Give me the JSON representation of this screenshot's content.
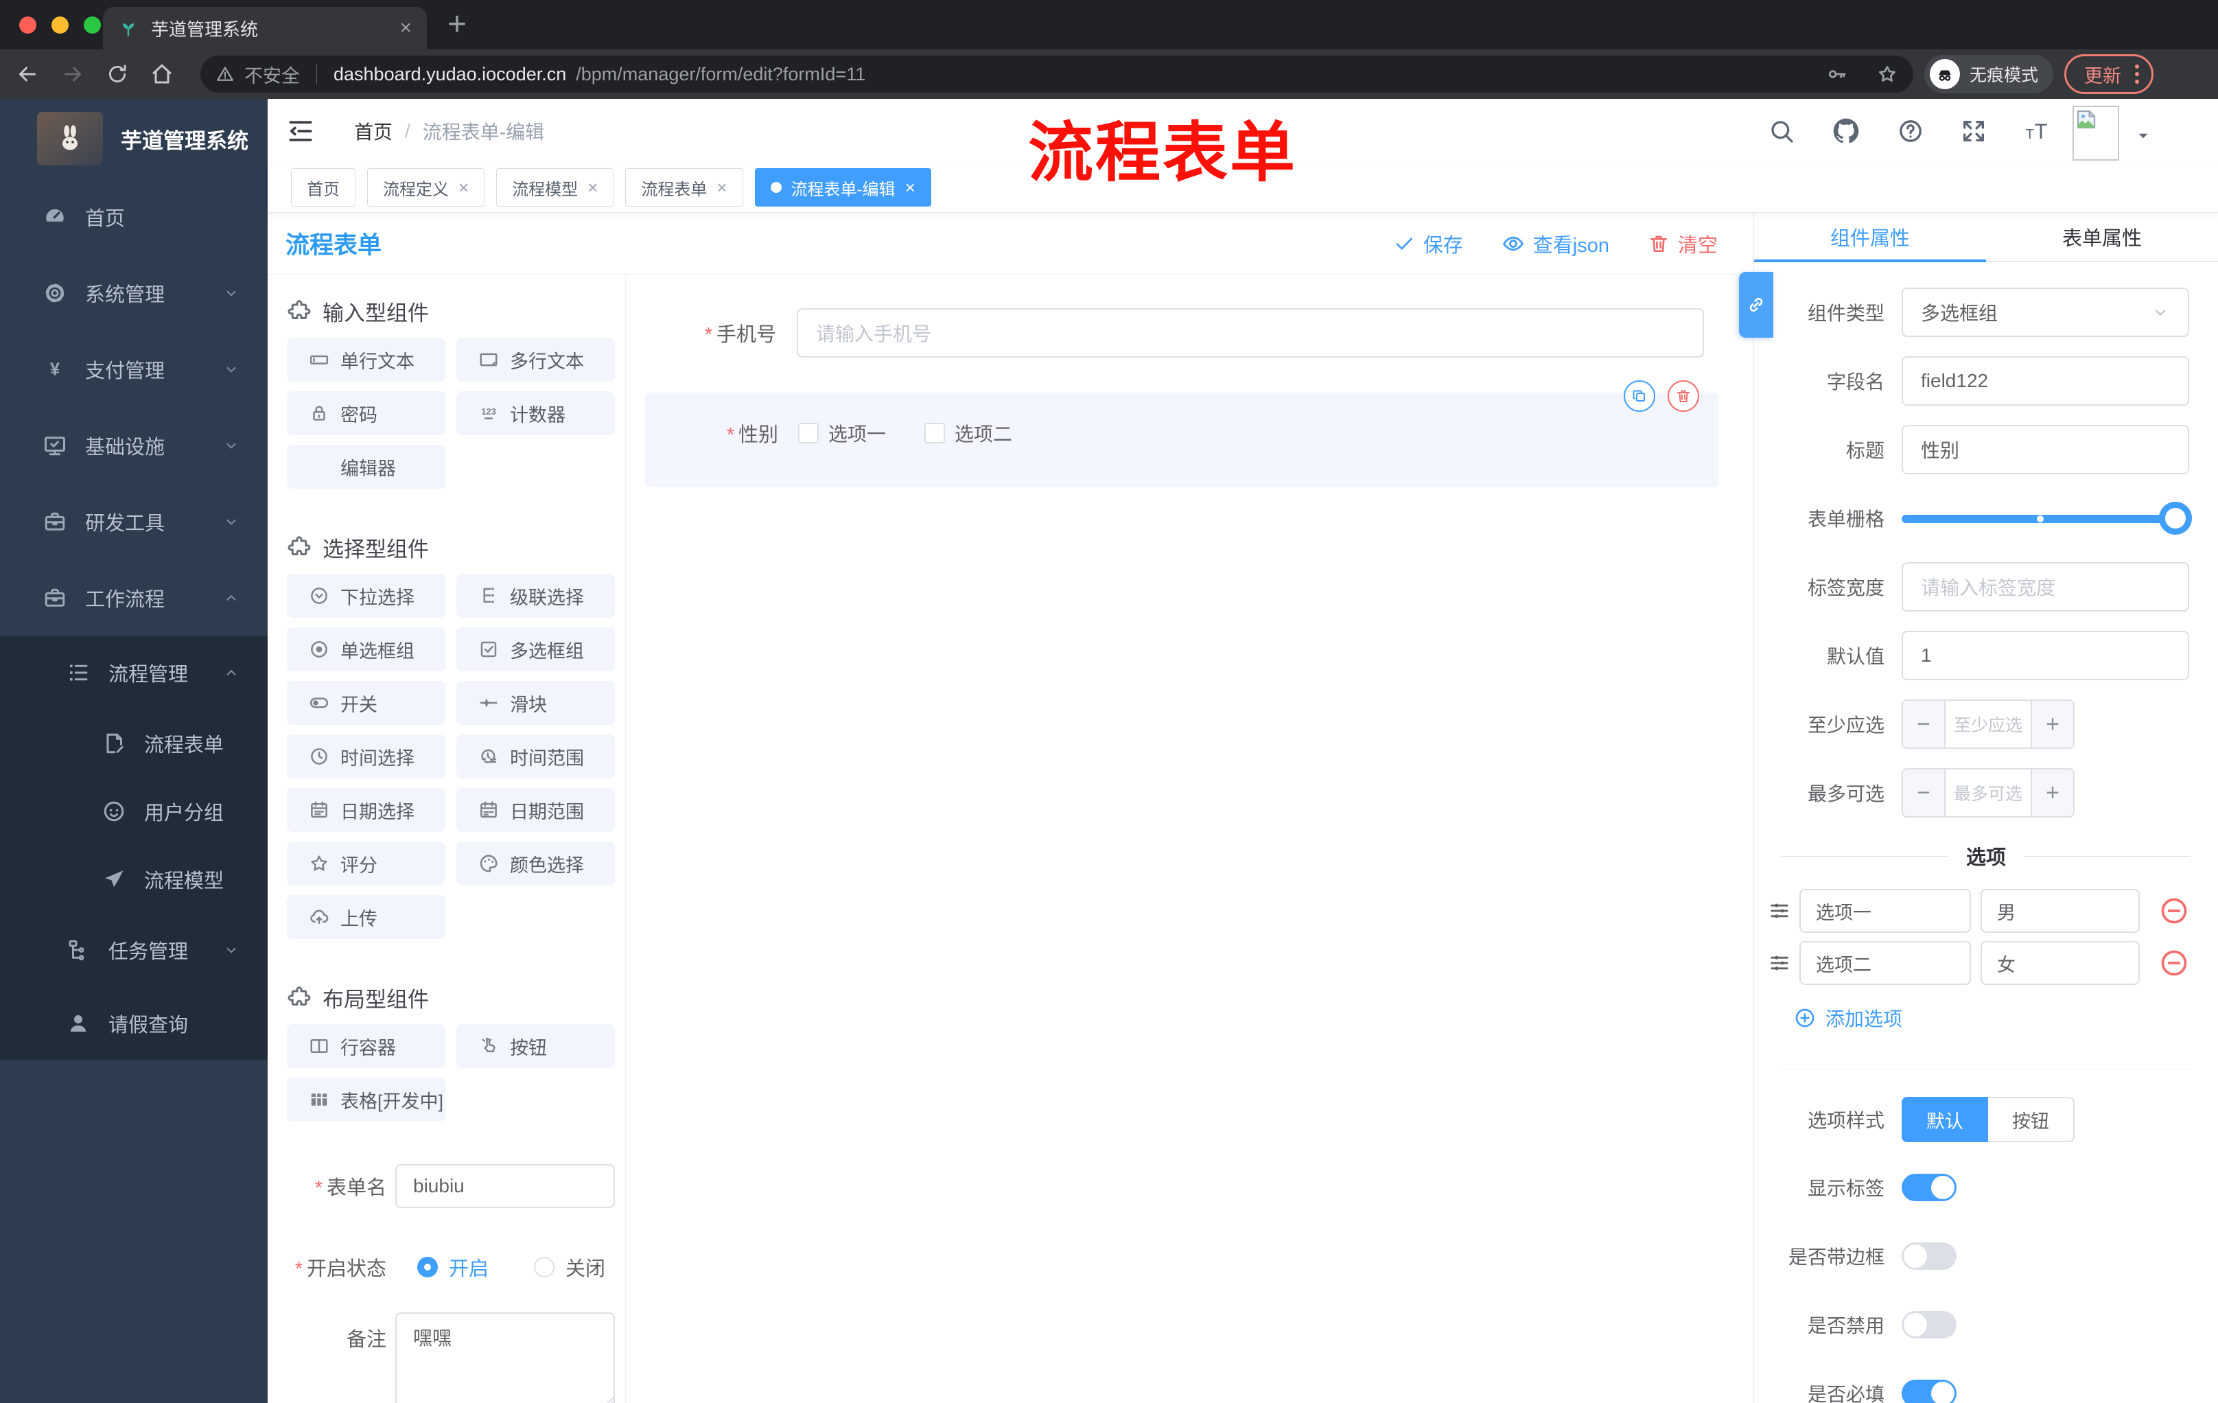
{
  "browser": {
    "tab_title": "芋道管理系统",
    "security_label": "不安全",
    "url_host": "dashboard.yudao.iocoder.cn",
    "url_path": "/bpm/manager/form/edit?formId=11",
    "incognito_label": "无痕模式",
    "update_label": "更新"
  },
  "sidebar": {
    "logo_title": "芋道管理系统",
    "items": [
      {
        "label": "首页",
        "icon": "dashboard",
        "level": 1,
        "chevron": "",
        "sub": false
      },
      {
        "label": "系统管理",
        "icon": "gear",
        "level": 1,
        "chevron": "down",
        "sub": false
      },
      {
        "label": "支付管理",
        "icon": "yen",
        "level": 1,
        "chevron": "down",
        "sub": false
      },
      {
        "label": "基础设施",
        "icon": "monitor",
        "level": 1,
        "chevron": "down",
        "sub": false
      },
      {
        "label": "研发工具",
        "icon": "briefcase",
        "level": 1,
        "chevron": "down",
        "sub": false
      },
      {
        "label": "工作流程",
        "icon": "briefcase",
        "level": 1,
        "chevron": "up",
        "sub": false
      },
      {
        "label": "流程管理",
        "icon": "flowlist",
        "level": 2,
        "chevron": "up",
        "sub": true
      },
      {
        "label": "流程表单",
        "icon": "docedit",
        "level": 3,
        "chevron": "",
        "sub": true
      },
      {
        "label": "用户分组",
        "icon": "face",
        "level": 3,
        "chevron": "",
        "sub": true
      },
      {
        "label": "流程模型",
        "icon": "plane",
        "level": 3,
        "chevron": "",
        "sub": true
      },
      {
        "label": "任务管理",
        "icon": "tree",
        "level": 2,
        "chevron": "down",
        "sub": true
      },
      {
        "label": "请假查询",
        "icon": "person",
        "level": 2,
        "chevron": "",
        "sub": true
      }
    ]
  },
  "header": {
    "breadcrumb": [
      "首页",
      "流程表单-编辑"
    ],
    "annotation": "流程表单"
  },
  "tabs": [
    {
      "label": "首页",
      "closable": false,
      "active": false
    },
    {
      "label": "流程定义",
      "closable": true,
      "active": false
    },
    {
      "label": "流程模型",
      "closable": true,
      "active": false
    },
    {
      "label": "流程表单",
      "closable": true,
      "active": false
    },
    {
      "label": "流程表单-编辑",
      "closable": true,
      "active": true
    }
  ],
  "editor": {
    "title": "流程表单",
    "actions": {
      "save": "保存",
      "view_json": "查看json",
      "clear": "清空"
    }
  },
  "palette": {
    "sections": [
      {
        "title": "输入型组件",
        "items": [
          {
            "label": "单行文本",
            "icon": "input"
          },
          {
            "label": "多行文本",
            "icon": "textarea"
          },
          {
            "label": "密码",
            "icon": "lock"
          },
          {
            "label": "计数器",
            "icon": "number"
          },
          {
            "label": "编辑器",
            "icon": ""
          }
        ]
      },
      {
        "title": "选择型组件",
        "items": [
          {
            "label": "下拉选择",
            "icon": "select"
          },
          {
            "label": "级联选择",
            "icon": "cascade"
          },
          {
            "label": "单选框组",
            "icon": "radio"
          },
          {
            "label": "多选框组",
            "icon": "checkbox"
          },
          {
            "label": "开关",
            "icon": "switch"
          },
          {
            "label": "滑块",
            "icon": "slider"
          },
          {
            "label": "时间选择",
            "icon": "time"
          },
          {
            "label": "时间范围",
            "icon": "timerange"
          },
          {
            "label": "日期选择",
            "icon": "date"
          },
          {
            "label": "日期范围",
            "icon": "daterange"
          },
          {
            "label": "评分",
            "icon": "star"
          },
          {
            "label": "颜色选择",
            "icon": "color"
          },
          {
            "label": "上传",
            "icon": "upload"
          }
        ]
      },
      {
        "title": "布局型组件",
        "items": [
          {
            "label": "行容器",
            "icon": "row"
          },
          {
            "label": "按钮",
            "icon": "button"
          },
          {
            "label": "表格[开发中]",
            "icon": "table"
          }
        ]
      }
    ]
  },
  "meta_form": {
    "name_label": "表单名",
    "name_value": "biubiu",
    "status_label": "开启状态",
    "status_on": "开启",
    "status_off": "关闭",
    "remark_label": "备注",
    "remark_value": "嘿嘿"
  },
  "canvas": {
    "phone": {
      "label": "手机号",
      "placeholder": "请输入手机号"
    },
    "gender": {
      "label": "性别",
      "options": [
        "选项一",
        "选项二"
      ]
    }
  },
  "panel": {
    "tab_component": "组件属性",
    "tab_form": "表单属性",
    "fields": {
      "type_label": "组件类型",
      "type_value": "多选框组",
      "field_label": "字段名",
      "field_value": "field122",
      "title_label": "标题",
      "title_value": "性别",
      "grid_label": "表单栅格",
      "label_width_label": "标签宽度",
      "label_width_placeholder": "请输入标签宽度",
      "default_label": "默认值",
      "default_value": "1",
      "min_label": "至少应选",
      "min_placeholder": "至少应选",
      "max_label": "最多可选",
      "max_placeholder": "最多可选"
    },
    "options_divider": "选项",
    "options": [
      {
        "label": "选项一",
        "value": "男"
      },
      {
        "label": "选项二",
        "value": "女"
      }
    ],
    "add_option": "添加选项",
    "style_label": "选项样式",
    "style_options": [
      "默认",
      "按钮"
    ],
    "style_selected": "默认",
    "toggles": [
      {
        "label": "显示标签",
        "on": true
      },
      {
        "label": "是否带边框",
        "on": false
      },
      {
        "label": "是否禁用",
        "on": false
      },
      {
        "label": "是否必填",
        "on": true
      }
    ]
  },
  "colors": {
    "accent": "#409eff",
    "danger": "#f56c6c",
    "annotation_red": "#fb1107",
    "sidebar_bg": "#2e3c50",
    "submenu_bg": "#212c3b",
    "title_blue": "#2b9af3"
  }
}
